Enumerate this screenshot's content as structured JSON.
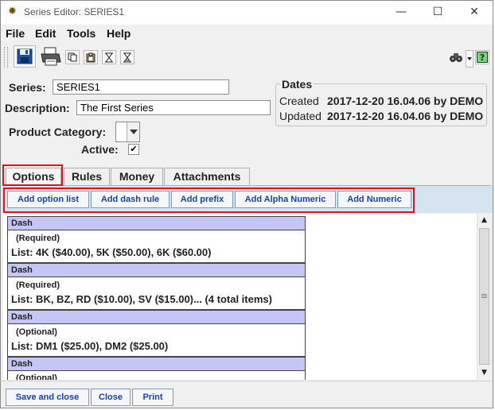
{
  "window": {
    "title": "Series Editor: SERIES1",
    "minimize_glyph": "—",
    "maximize_glyph": "☐",
    "close_glyph": "✕"
  },
  "menu": {
    "items": [
      "File",
      "Edit",
      "Tools",
      "Help"
    ]
  },
  "toolbar": {
    "buttons": [
      "save-icon",
      "print-icon",
      "copy-icon",
      "paste-icon",
      "hourglass-icon",
      "hourglass-alt-icon"
    ],
    "right_buttons": [
      "binoculars-icon",
      "dropdown-arrow-icon",
      "help-icon"
    ]
  },
  "form": {
    "series_label": "Series:",
    "series_value": "SERIES1",
    "description_label": "Description:",
    "description_value": "The First Series",
    "product_category_label": "Product Category:",
    "product_category_value": "",
    "active_label": "Active:",
    "active_checked": true
  },
  "dates": {
    "title": "Dates",
    "created_label": "Created",
    "created_value": "2017-12-20 16.04.06 by DEMO",
    "updated_label": "Updated",
    "updated_value": "2017-12-20 16.04.06 by DEMO"
  },
  "tabs": {
    "items": [
      "Options",
      "Rules",
      "Money",
      "Attachments"
    ],
    "active": "Options"
  },
  "options": {
    "buttons": [
      "Add option list",
      "Add dash rule",
      "Add prefix",
      "Add Alpha Numeric",
      "Add Numeric"
    ]
  },
  "rules": [
    {
      "header": "Dash",
      "requirement": "(Required)",
      "list": "List: 4K ($40.00), 5K ($50.00), 6K ($60.00)"
    },
    {
      "header": "Dash",
      "requirement": "(Required)",
      "list": "List: BK, BZ, RD ($10.00), SV ($15.00)... (4 total items)"
    },
    {
      "header": "Dash",
      "requirement": "(Optional)",
      "list": "List: DM1 ($25.00), DM2 ($25.00)"
    },
    {
      "header": "Dash",
      "requirement": "(Optional)",
      "list": ""
    }
  ],
  "footer": {
    "save_close": "Save and close",
    "close": "Close",
    "print": "Print"
  },
  "colors": {
    "highlight_red": "#e0101c",
    "rule_header": "#c6c6f6",
    "options_bar": "#d6e4f2",
    "button_text": "#1a3fb0"
  }
}
